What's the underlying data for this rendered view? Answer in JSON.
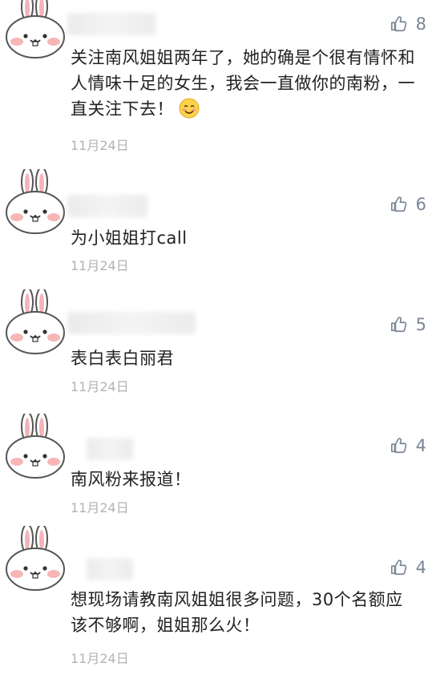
{
  "comments": [
    {
      "text": "关注南风姐姐两年了，她的确是个很有情怀和人情味十足的女生，我会一直做你的南粉，一直关注下去！",
      "emoji": "smiling-face-emoji",
      "date": "11月24日",
      "likes": "8"
    },
    {
      "text": "为小姐姐打call",
      "date": "11月24日",
      "likes": "6"
    },
    {
      "text": "表白表白丽君",
      "date": "11月24日",
      "likes": "5"
    },
    {
      "text": "南风粉来报道！",
      "date": "11月24日",
      "likes": "4"
    },
    {
      "text": "想现场请教南风姐姐很多问题，30个名额应该不够啊，姐姐那么火！",
      "date": "11月24日",
      "likes": "4"
    }
  ],
  "colors": {
    "like_icon": "#7a8597",
    "date_text": "#b3b3b3",
    "body_text": "#222222",
    "avatar_blush": "#f7b6b6"
  },
  "icons": {
    "like": "thumbs-up-icon",
    "avatar": "bunny-avatar-icon"
  }
}
